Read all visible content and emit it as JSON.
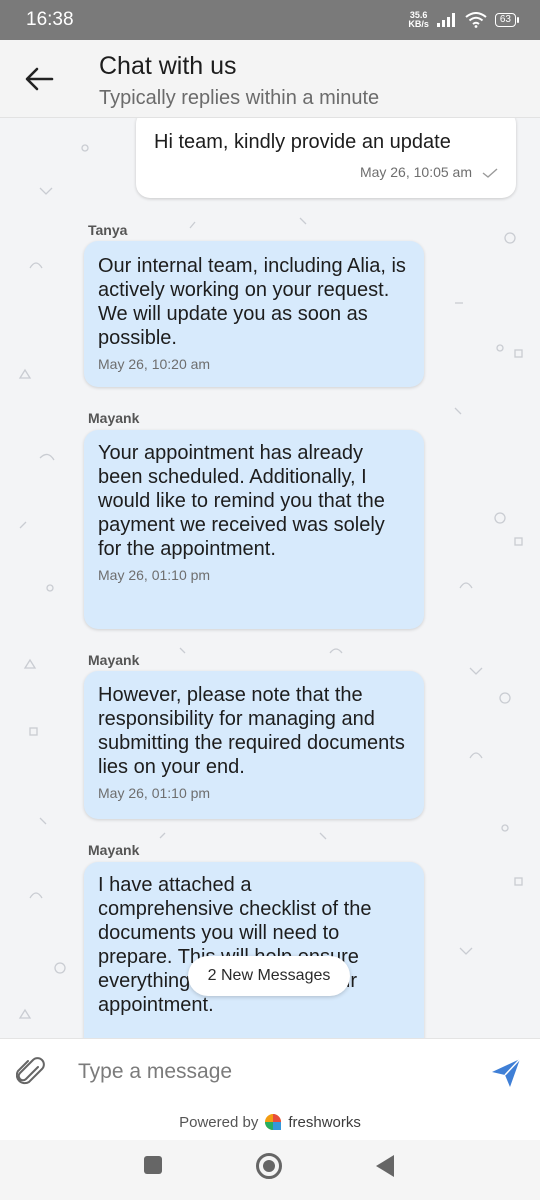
{
  "status_bar": {
    "time": "16:38",
    "net_speed_value": "35.6",
    "net_speed_unit": "KB/s",
    "battery": "63"
  },
  "header": {
    "title": "Chat with us",
    "subtitle": "Typically replies within a minute"
  },
  "messages": [
    {
      "direction": "outgoing",
      "sender": "",
      "text": "Hi team, kindly provide an update",
      "time": "May 26, 10:05 am"
    },
    {
      "direction": "incoming",
      "sender": "Tanya",
      "text": "Our internal team, including Alia, is actively working on your request. We will update you as soon as possible.",
      "time": "May 26, 10:20 am"
    },
    {
      "direction": "incoming",
      "sender": "Mayank",
      "text": "Your appointment has already been scheduled. Additionally, I would like to remind you that the payment we received was solely for the appointment.",
      "time": "May 26, 01:10 pm"
    },
    {
      "direction": "incoming",
      "sender": "Mayank",
      "text": "However, please note that the responsibility for managing and submitting the required documents lies on your end.",
      "time": "May 26, 01:10 pm"
    },
    {
      "direction": "incoming",
      "sender": "Mayank",
      "text": "I have attached a comprehensive checklist of the documents you will need to prepare. This will help ensure everything is in order for your appointment.",
      "time": ""
    }
  ],
  "new_messages_pill": "2 New Messages",
  "composer": {
    "placeholder": "Type a message"
  },
  "footer": {
    "powered_by": "Powered by",
    "brand": "freshworks"
  },
  "colors": {
    "incoming_bubble": "#d7eafc",
    "outgoing_bubble": "#ffffff",
    "send_icon": "#3f7fd6",
    "chat_background": "#f3f4f6"
  }
}
